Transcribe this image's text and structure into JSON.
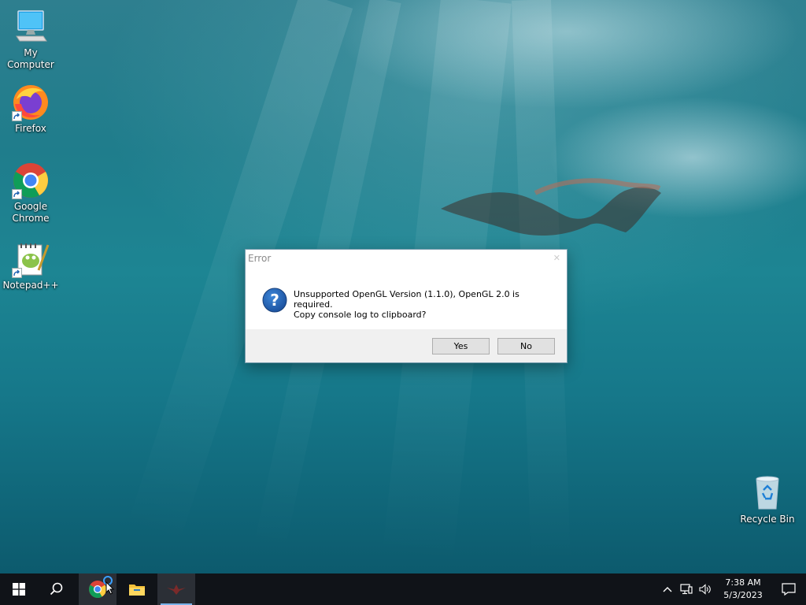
{
  "desktop": {
    "icons": [
      {
        "label": "My Computer",
        "icon": "computer-icon"
      },
      {
        "label": "Firefox",
        "icon": "firefox-icon"
      },
      {
        "label": "Google Chrome",
        "icon": "chrome-icon"
      },
      {
        "label": "Notepad++",
        "icon": "notepad-plus-plus-icon"
      },
      {
        "label": "Recycle Bin",
        "icon": "recycle-bin-icon"
      }
    ]
  },
  "dialog": {
    "title": "Error",
    "close_glyph": "✕",
    "message_line1": "Unsupported OpenGL Version (1.1.0), OpenGL 2.0 is required.",
    "message_line2": "Copy console log to clipboard?",
    "yes_label": "Yes",
    "no_label": "No",
    "icon": "question-icon"
  },
  "taskbar": {
    "time": "7:38 AM",
    "date": "5/3/2023",
    "items": [
      "windows-start-icon",
      "search-icon",
      "chrome-icon",
      "file-explorer-icon",
      "game-app-icon"
    ],
    "tray": [
      "chevron-up-icon",
      "network-icon",
      "volume-icon",
      "notification-icon"
    ]
  },
  "colors": {
    "accent": "#79b3ea",
    "dialog_button": "#e1e1e1",
    "question_icon": "#1e5ca8"
  }
}
